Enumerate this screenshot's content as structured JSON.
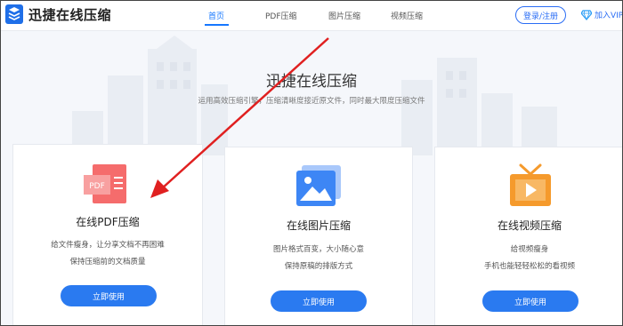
{
  "header": {
    "logo_text": "迅捷在线压缩",
    "nav": [
      {
        "label": "首页",
        "active": true
      },
      {
        "label": "PDF压缩",
        "active": false
      },
      {
        "label": "图片压缩",
        "active": false
      },
      {
        "label": "视频压缩",
        "active": false
      }
    ],
    "login_label": "登录/注册",
    "vip_label": "加入VIP"
  },
  "hero": {
    "title": "迅捷在线压缩",
    "subtitle": "运用高效压缩引擎，压缩清晰度接近原文件，同时最大限度压缩文件"
  },
  "cards": [
    {
      "icon": "pdf-file-icon",
      "icon_text": "PDF",
      "title": "在线PDF压缩",
      "desc": [
        "给文件瘦身，让分享文档不再困难",
        "保持压缩前的文档质量"
      ],
      "button": "立即使用"
    },
    {
      "icon": "image-icon",
      "title": "在线图片压缩",
      "desc": [
        "图片格式百变，大小随心意",
        "保持原稿的排版方式"
      ],
      "button": "立即使用"
    },
    {
      "icon": "tv-play-icon",
      "title": "在线视频压缩",
      "desc": [
        "给视频瘦身",
        "手机也能轻轻松松的看视频"
      ],
      "button": "立即使用"
    }
  ],
  "colors": {
    "accent": "#1677ff",
    "button": "#2a7af0",
    "pdf_red": "#f25c5c",
    "image_blue": "#3d86f5",
    "video_orange": "#f59a2c",
    "annotation_arrow": "#e02020"
  }
}
